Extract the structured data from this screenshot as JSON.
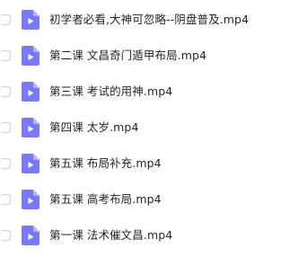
{
  "colors": {
    "file_icon": "#7b78f6",
    "file_icon_fold": "#b9b7fb",
    "text": "#1f2329",
    "checkbox_border": "#cfd2d8"
  },
  "files": [
    {
      "name": "初学者必看,大神可忽略--阴盘普及.mp4",
      "icon": "video-file-icon"
    },
    {
      "name": "第二课 文昌奇门遁甲布局.mp4",
      "icon": "video-file-icon"
    },
    {
      "name": "第三课 考试的用神.mp4",
      "icon": "video-file-icon"
    },
    {
      "name": "第四课 太岁.mp4",
      "icon": "video-file-icon"
    },
    {
      "name": "第五课 布局补充.mp4",
      "icon": "video-file-icon"
    },
    {
      "name": "第五课 高考布局.mp4",
      "icon": "video-file-icon"
    },
    {
      "name": "第一课 法术催文昌.mp4",
      "icon": "video-file-icon"
    }
  ]
}
